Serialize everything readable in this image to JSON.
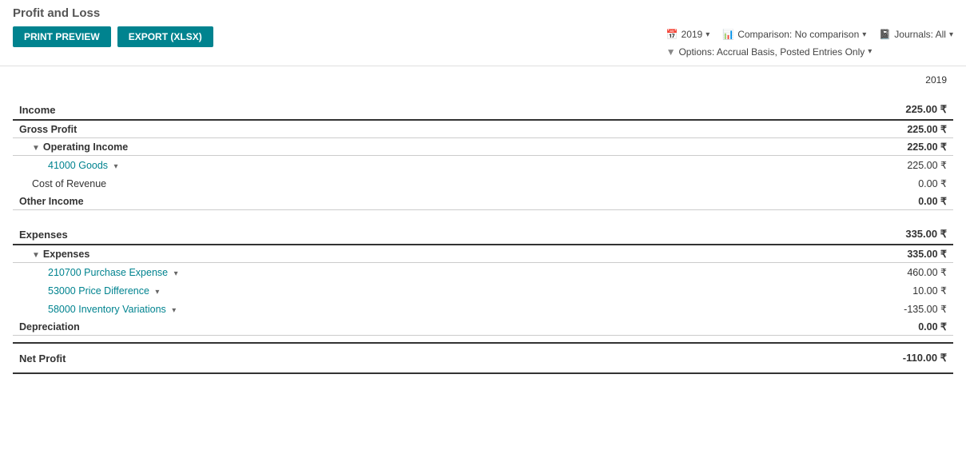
{
  "page": {
    "title": "Profit and Loss"
  },
  "toolbar": {
    "print_preview": "PRINT PREVIEW",
    "export_xlsx": "EXPORT (XLSX)",
    "year_filter": "2019",
    "comparison_filter": "Comparison: No comparison",
    "journals_filter": "Journals: All",
    "options_filter": "Options: Accrual Basis, Posted Entries Only"
  },
  "report": {
    "year_col": "2019",
    "sections": [
      {
        "label": "Income",
        "value": "225.00 ₹",
        "type": "section-header",
        "children": [
          {
            "label": "Gross Profit",
            "value": "225.00 ₹",
            "type": "subsection-header",
            "indent": 0
          },
          {
            "label": "Operating Income",
            "value": "225.00 ₹",
            "type": "subsection-indent",
            "indent": 1,
            "children": [
              {
                "label": "41000 Goods",
                "value": "225.00 ₹",
                "type": "account",
                "indent": 2,
                "has_caret": true
              },
              {
                "label": "Cost of Revenue",
                "value": "0.00 ₹",
                "type": "normal-dimmed",
                "indent": 1
              }
            ]
          },
          {
            "label": "Other Income",
            "value": "0.00 ₹",
            "type": "subsection-header",
            "indent": 0
          }
        ]
      },
      {
        "label": "Expenses",
        "value": "335.00 ₹",
        "type": "section-header",
        "children": [
          {
            "label": "Expenses",
            "value": "335.00 ₹",
            "type": "subsection-indent",
            "indent": 1,
            "children": [
              {
                "label": "210700 Purchase Expense",
                "value": "460.00 ₹",
                "type": "account",
                "indent": 2,
                "has_caret": true
              },
              {
                "label": "53000 Price Difference",
                "value": "10.00 ₹",
                "type": "account",
                "indent": 2,
                "has_caret": true
              },
              {
                "label": "58000 Inventory Variations",
                "value": "-135.00 ₹",
                "type": "account",
                "indent": 2,
                "has_caret": true
              }
            ]
          },
          {
            "label": "Depreciation",
            "value": "0.00 ₹",
            "type": "subsection-header",
            "indent": 0
          }
        ]
      }
    ],
    "net_profit": {
      "label": "Net Profit",
      "value": "-110.00 ₹"
    }
  }
}
